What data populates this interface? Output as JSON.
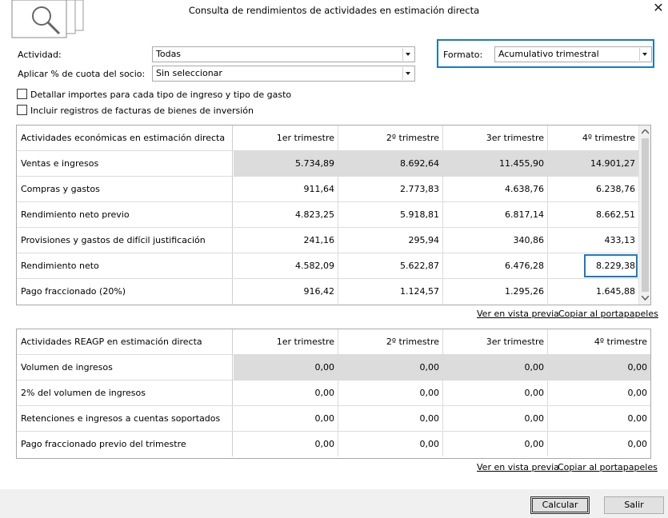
{
  "window": {
    "title": "Consulta de rendimientos de actividades en estimación directa",
    "close_glyph": "✕"
  },
  "form": {
    "actividad_label": "Actividad:",
    "actividad_value": "Todas",
    "cuota_label": "Aplicar % de cuota del socio:",
    "cuota_value": "Sin seleccionar",
    "formato_label": "Formato:",
    "formato_value": "Acumulativo trimestral",
    "check_detallar": "Detallar importes para cada tipo de ingreso y tipo de gasto",
    "check_incluir": "Incluir registros de facturas de bienes de inversión"
  },
  "table1": {
    "headers": [
      "Actividades económicas en estimación directa",
      "1er trimestre",
      "2º trimestre",
      "3er trimestre",
      "4º trimestre"
    ],
    "rows": [
      {
        "label": "Ventas e ingresos",
        "values": [
          "5.734,89",
          "8.692,64",
          "11.455,90",
          "14.901,27"
        ]
      },
      {
        "label": "Compras y gastos",
        "values": [
          "911,64",
          "2.773,83",
          "4.638,76",
          "6.238,76"
        ]
      },
      {
        "label": "Rendimiento neto previo",
        "values": [
          "4.823,25",
          "5.918,81",
          "6.817,14",
          "8.662,51"
        ]
      },
      {
        "label": "Provisiones y gastos de difícil justificación",
        "values": [
          "241,16",
          "295,94",
          "340,86",
          "433,13"
        ]
      },
      {
        "label": "Rendimiento neto",
        "values": [
          "4.582,09",
          "5.622,87",
          "6.476,28",
          "8.229,38"
        ]
      },
      {
        "label": "Pago fraccionado (20%)",
        "values": [
          "916,42",
          "1.124,57",
          "1.295,26",
          "1.645,88"
        ]
      }
    ],
    "link_preview": "Ver en vista previa",
    "link_copy": "Copiar al portapapeles"
  },
  "table2": {
    "headers": [
      "Actividades REAGP en estimación directa",
      "1er trimestre",
      "2º trimestre",
      "3er trimestre",
      "4º trimestre"
    ],
    "rows": [
      {
        "label": "Volumen de ingresos",
        "values": [
          "0,00",
          "0,00",
          "0,00",
          "0,00"
        ]
      },
      {
        "label": "2% del volumen de ingresos",
        "values": [
          "0,00",
          "0,00",
          "0,00",
          "0,00"
        ]
      },
      {
        "label": "Retenciones e ingresos a cuentas soportados",
        "values": [
          "0,00",
          "0,00",
          "0,00",
          "0,00"
        ]
      },
      {
        "label": "Pago fraccionado previo del trimestre",
        "values": [
          "0,00",
          "0,00",
          "0,00",
          "0,00"
        ]
      }
    ],
    "link_preview": "Ver en vista previa",
    "link_copy": "Copiar al portapapeles"
  },
  "buttons": {
    "calcular": "Calcular",
    "salir": "Salir"
  },
  "colors": {
    "accent": "#1b7ac3",
    "highlight_row": "#dcdcdc",
    "footer_bg": "#f0f0f0"
  }
}
